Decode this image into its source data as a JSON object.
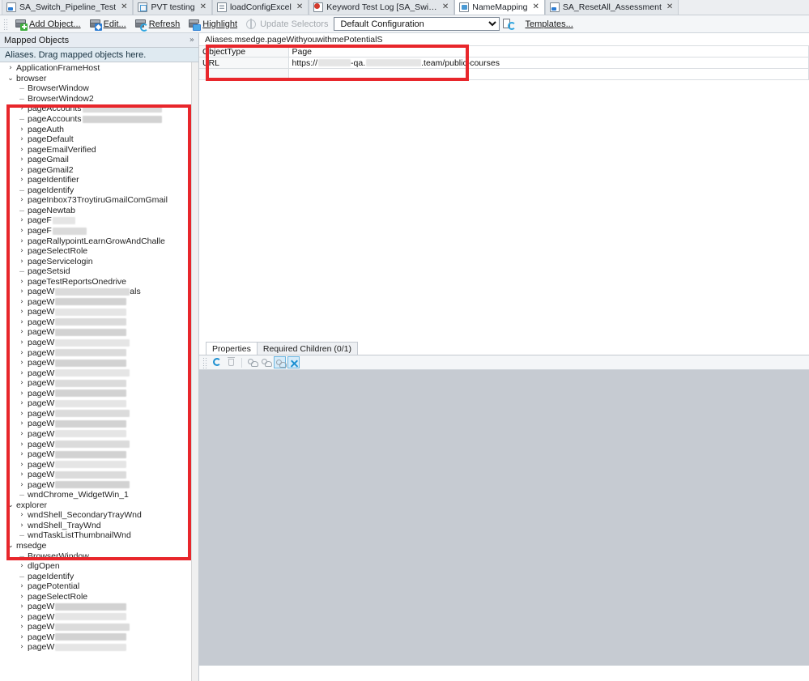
{
  "tabs": [
    {
      "label": "SA_Switch_Pipeline_Test",
      "icon": "blue-script-icon",
      "icon_class": "ic-blue",
      "active": false
    },
    {
      "label": "PVT testing",
      "icon": "page-icon",
      "icon_class": "ic-doc",
      "active": false
    },
    {
      "label": "loadConfigExcel",
      "icon": "document-icon",
      "icon_class": "ic-page",
      "active": false
    },
    {
      "label": "Keyword Test Log [SA_Switch_Pipe...",
      "icon": "keyword-test-log-icon",
      "icon_class": "ic-keyw",
      "active": false
    },
    {
      "label": "NameMapping",
      "icon": "name-mapping-icon",
      "icon_class": "ic-nm",
      "active": true
    },
    {
      "label": "SA_ResetAll_Assessment",
      "icon": "blue-script-icon",
      "icon_class": "ic-blue",
      "active": false
    }
  ],
  "tab_close_glyph": "✕",
  "toolbar": {
    "add_object": "Add Object...",
    "edit": "Edit...",
    "refresh": "Refresh",
    "highlight": "Highlight",
    "update_selectors": "Update Selectors",
    "configuration_value": "Default Configuration",
    "configuration_options": [
      "Default Configuration"
    ],
    "templates": "Templates..."
  },
  "left_panel": {
    "header": "Mapped Objects",
    "collapse_glyph": "»",
    "alias_hint": "Aliases. Drag mapped objects here.",
    "tree": [
      {
        "indent": 0,
        "twisty": ">",
        "label": "ApplicationFrameHost"
      },
      {
        "indent": 0,
        "twisty": "v",
        "label": "browser"
      },
      {
        "indent": 1,
        "twisty": "-",
        "label": "BrowserWindow"
      },
      {
        "indent": 1,
        "twisty": "-",
        "label": "BrowserWindow2"
      },
      {
        "indent": 1,
        "twisty": ">",
        "label": "pageAccounts",
        "redact": 98
      },
      {
        "indent": 1,
        "twisty": "-",
        "label": "pageAccounts",
        "redact": 98
      },
      {
        "indent": 1,
        "twisty": ">",
        "label": "pageAuth"
      },
      {
        "indent": 1,
        "twisty": ">",
        "label": "pageDefault"
      },
      {
        "indent": 1,
        "twisty": ">",
        "label": "pageEmailVerified"
      },
      {
        "indent": 1,
        "twisty": ">",
        "label": "pageGmail"
      },
      {
        "indent": 1,
        "twisty": ">",
        "label": "pageGmail2"
      },
      {
        "indent": 1,
        "twisty": ">",
        "label": "pageIdentifier"
      },
      {
        "indent": 1,
        "twisty": "-",
        "label": "pageIdentify"
      },
      {
        "indent": 1,
        "twisty": ">",
        "label": "pageInbox73TroytiruGmailComGmail"
      },
      {
        "indent": 1,
        "twisty": "-",
        "label": "pageNewtab"
      },
      {
        "indent": 1,
        "twisty": ">",
        "label": "pageF",
        "redact": 28
      },
      {
        "indent": 1,
        "twisty": ">",
        "label": "pageF",
        "redact": 42
      },
      {
        "indent": 1,
        "twisty": ">",
        "label": "pageRallypointLearnGrowAndChalle"
      },
      {
        "indent": 1,
        "twisty": ">",
        "label": "pageSelectRole"
      },
      {
        "indent": 1,
        "twisty": ">",
        "label": "pageServicelogin"
      },
      {
        "indent": 1,
        "twisty": "-",
        "label": "pageSetsid"
      },
      {
        "indent": 1,
        "twisty": ">",
        "label": "pageTestReportsOnedrive"
      },
      {
        "indent": 1,
        "twisty": ">",
        "label": "pageW",
        "redact": 92,
        "suffix": "als"
      },
      {
        "indent": 1,
        "twisty": ">",
        "label": "pageW",
        "redact": 88
      },
      {
        "indent": 1,
        "twisty": ">",
        "label": "pageW",
        "redact": 88
      },
      {
        "indent": 1,
        "twisty": ">",
        "label": "pageW",
        "redact": 88
      },
      {
        "indent": 1,
        "twisty": ">",
        "label": "pageW",
        "redact": 88
      },
      {
        "indent": 1,
        "twisty": ">",
        "label": "pageW",
        "redact": 92
      },
      {
        "indent": 1,
        "twisty": ">",
        "label": "pageW",
        "redact": 88
      },
      {
        "indent": 1,
        "twisty": ">",
        "label": "pageW",
        "redact": 88
      },
      {
        "indent": 1,
        "twisty": ">",
        "label": "pageW",
        "redact": 92
      },
      {
        "indent": 1,
        "twisty": ">",
        "label": "pageW",
        "redact": 88
      },
      {
        "indent": 1,
        "twisty": ">",
        "label": "pageW",
        "redact": 88
      },
      {
        "indent": 1,
        "twisty": ">",
        "label": "pageW",
        "redact": 88
      },
      {
        "indent": 1,
        "twisty": ">",
        "label": "pageW",
        "redact": 92
      },
      {
        "indent": 1,
        "twisty": ">",
        "label": "pageW",
        "redact": 88
      },
      {
        "indent": 1,
        "twisty": ">",
        "label": "pageW",
        "redact": 88
      },
      {
        "indent": 1,
        "twisty": ">",
        "label": "pageW",
        "redact": 92
      },
      {
        "indent": 1,
        "twisty": ">",
        "label": "pageW",
        "redact": 88
      },
      {
        "indent": 1,
        "twisty": ">",
        "label": "pageW",
        "redact": 88
      },
      {
        "indent": 1,
        "twisty": ">",
        "label": "pageW",
        "redact": 88
      },
      {
        "indent": 1,
        "twisty": ">",
        "label": "pageW",
        "redact": 92
      },
      {
        "indent": 1,
        "twisty": "-",
        "label": "wndChrome_WidgetWin_1"
      },
      {
        "indent": 0,
        "twisty": "v",
        "label": "explorer"
      },
      {
        "indent": 1,
        "twisty": ">",
        "label": "wndShell_SecondaryTrayWnd"
      },
      {
        "indent": 1,
        "twisty": ">",
        "label": "wndShell_TrayWnd"
      },
      {
        "indent": 1,
        "twisty": "-",
        "label": "wndTaskListThumbnailWnd"
      },
      {
        "indent": 0,
        "twisty": "v",
        "label": "msedge"
      },
      {
        "indent": 1,
        "twisty": "-",
        "label": "BrowserWindow"
      },
      {
        "indent": 1,
        "twisty": ">",
        "label": "dlgOpen"
      },
      {
        "indent": 1,
        "twisty": "-",
        "label": "pageIdentify"
      },
      {
        "indent": 1,
        "twisty": ">",
        "label": "pagePotential"
      },
      {
        "indent": 1,
        "twisty": ">",
        "label": "pageSelectRole"
      },
      {
        "indent": 1,
        "twisty": ">",
        "label": "pageW",
        "redact": 88
      },
      {
        "indent": 1,
        "twisty": ">",
        "label": "pageW",
        "redact": 88
      },
      {
        "indent": 1,
        "twisty": ">",
        "label": "pageW",
        "redact": 92
      },
      {
        "indent": 1,
        "twisty": ">",
        "label": "pageW",
        "redact": 88
      },
      {
        "indent": 1,
        "twisty": ">",
        "label": "pageW",
        "redact": 88
      }
    ]
  },
  "right_panel": {
    "alias_path": "Aliases.msedge.pageWithyouwithmePotentialS",
    "properties": [
      {
        "name": "ObjectType",
        "value": "Page"
      },
      {
        "name": "URL",
        "value_prefix": "https://",
        "value_mid": "-qa.",
        "value_suffix": ".team/public-courses"
      }
    ],
    "bottom_tabs": [
      {
        "label": "Properties",
        "active": true
      },
      {
        "label": "Required Children (0/1)",
        "active": false
      }
    ],
    "bottom_toolbar_icons": [
      {
        "name": "refresh-icon",
        "enabled": true
      },
      {
        "name": "delete-icon",
        "enabled": false
      },
      {
        "name": "add-child-icon",
        "enabled": false
      },
      {
        "name": "remove-child-icon",
        "enabled": false
      },
      {
        "name": "highlight-child-icon",
        "enabled": true,
        "selected": true
      },
      {
        "name": "expand-all-icon",
        "enabled": true,
        "selected": true
      }
    ]
  },
  "annotations": {
    "highlight_color": "#e8262b",
    "boxes": [
      {
        "name": "tree-browser-highlight"
      },
      {
        "name": "properties-grid-highlight"
      }
    ]
  }
}
